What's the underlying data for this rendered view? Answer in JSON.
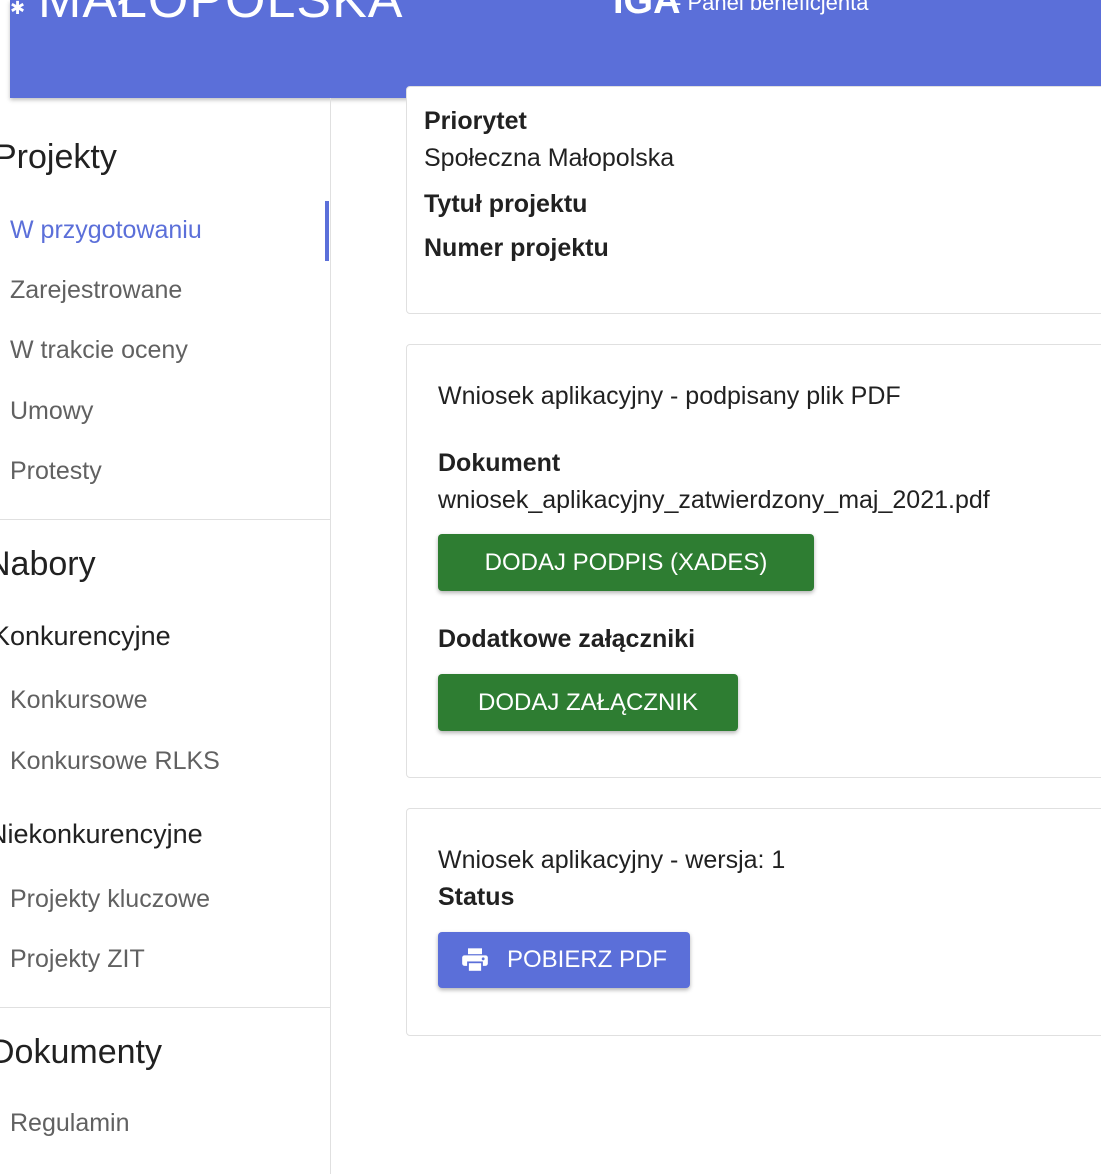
{
  "header": {
    "logo_text": "MAŁOPOLSKA",
    "app_name": "IGA",
    "subtitle": "- Panel beneficjenta"
  },
  "sidebar": {
    "projects_title": "Projekty",
    "project_items": [
      "W przygotowaniu",
      "Zarejestrowane",
      "W trakcie oceny",
      "Umowy",
      "Protesty"
    ],
    "calls_title": "Nabory",
    "competitive_title": "Konkurencyjne",
    "competitive_items": [
      "Konkursowe",
      "Konkursowe RLKS"
    ],
    "noncompetitive_title": "Niekonkurencyjne",
    "noncompetitive_items": [
      "Projekty kluczowe",
      "Projekty ZIT"
    ],
    "documents_title": "Dokumenty",
    "document_items": [
      "Regulamin"
    ]
  },
  "project_card": {
    "priority_label": "Priorytet",
    "priority_value": "Społeczna Małopolska",
    "title_label": "Tytuł projektu",
    "number_label": "Numer projektu"
  },
  "signed_pdf_card": {
    "heading": "Wniosek aplikacyjny - podpisany plik PDF",
    "document_label": "Dokument",
    "document_filename": "wniosek_aplikacyjny_zatwierdzony_maj_2021.pdf",
    "add_signature_button": "DODAJ PODPIS (XADES)",
    "attachments_label": "Dodatkowe załączniki",
    "add_attachment_button": "DODAJ ZAŁĄCZNIK"
  },
  "version_card": {
    "heading": "Wniosek aplikacyjny - wersja: 1",
    "status_label": "Status",
    "download_pdf_button": "POBIERZ PDF",
    "download_icon": "printer-icon"
  },
  "colors": {
    "primary": "#5b6fd9",
    "success": "#2e7d32",
    "muted_text": "#616161"
  }
}
